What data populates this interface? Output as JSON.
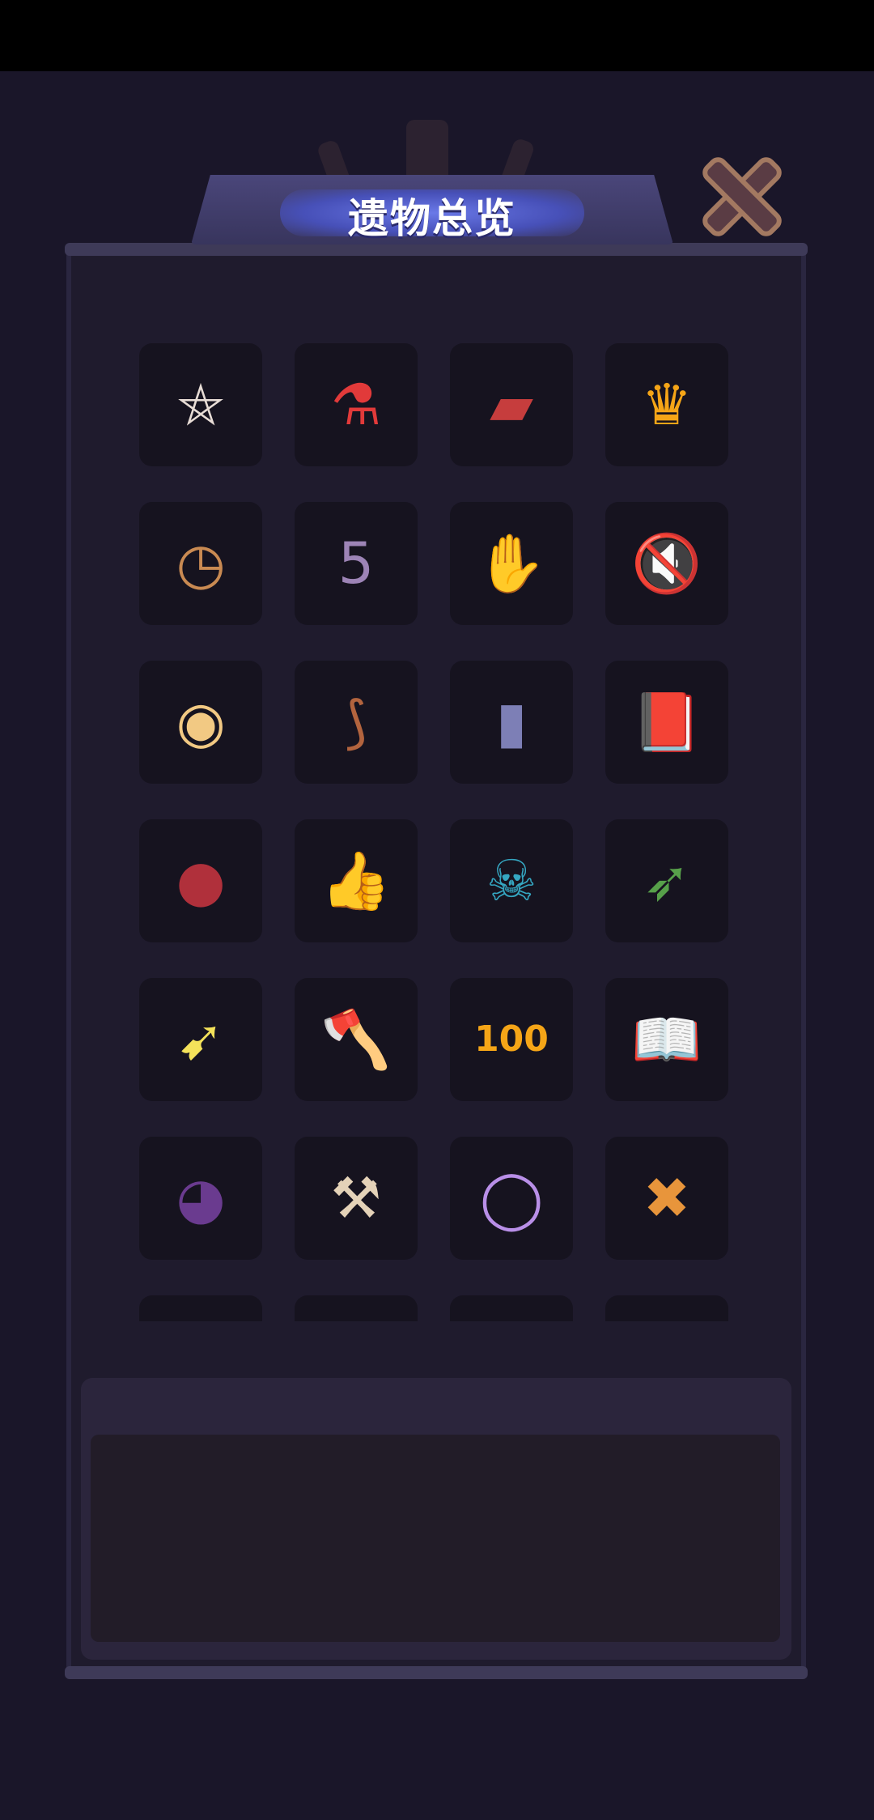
{
  "screen": {
    "title": "遗物总览"
  },
  "relics": [
    {
      "icon": "pentagram-plate-icon",
      "glyph": "⛤",
      "color": "#e8ddd6"
    },
    {
      "icon": "winged-potion-icon",
      "glyph": "⚗",
      "color": "#e23a3a"
    },
    {
      "icon": "red-armor-icon",
      "glyph": "▰",
      "color": "#c63d3d"
    },
    {
      "icon": "crown-card-icon",
      "glyph": "♛",
      "color": "#f5a517"
    },
    {
      "icon": "pocket-watch-icon",
      "glyph": "◷",
      "color": "#c98a52"
    },
    {
      "icon": "skull-calendar-icon",
      "glyph": "5",
      "color": "#9d84b6"
    },
    {
      "icon": "handshake-icon",
      "glyph": "✋",
      "color": "#e8dcc0"
    },
    {
      "icon": "mute-sound-icon",
      "glyph": "🔇",
      "color": "#34b39a"
    },
    {
      "icon": "round-shield-icon",
      "glyph": "◉",
      "color": "#f2c983"
    },
    {
      "icon": "wooden-bow-icon",
      "glyph": "⟆",
      "color": "#b3643e"
    },
    {
      "icon": "stone-block-icon",
      "glyph": "▮",
      "color": "#7d7fb6"
    },
    {
      "icon": "purple-spellbook-icon",
      "glyph": "📕",
      "color": "#a85ee0"
    },
    {
      "icon": "bitten-apple-icon",
      "glyph": "●",
      "color": "#b0303b"
    },
    {
      "icon": "thumbs-up-icon",
      "glyph": "👍",
      "color": "#f2c224"
    },
    {
      "icon": "vine-skull-icon",
      "glyph": "☠",
      "color": "#35a7c2"
    },
    {
      "icon": "arrow-quiver-icon",
      "glyph": "➶",
      "color": "#57a04a"
    },
    {
      "icon": "feather-arrow-icon",
      "glyph": "➹",
      "color": "#f4e25a"
    },
    {
      "icon": "purple-axe-icon",
      "glyph": "🪓",
      "color": "#7f4cb5"
    },
    {
      "icon": "level-100-house-icon",
      "glyph": "100",
      "color": "#f5a517"
    },
    {
      "icon": "cursed-spellbook-icon",
      "glyph": "📖",
      "color": "#e24fb0"
    },
    {
      "icon": "masked-face-icon",
      "glyph": "◕",
      "color": "#6a3b8f"
    },
    {
      "icon": "wooden-signpost-icon",
      "glyph": "⚒",
      "color": "#e4d2b8"
    },
    {
      "icon": "rainbow-ring-icon",
      "glyph": "◯",
      "color": "#b98fe8"
    },
    {
      "icon": "crossed-balloon-icon",
      "glyph": "✖",
      "color": "#e8953b"
    },
    {
      "icon": "cut-off-relic-1-icon",
      "glyph": "▲",
      "color": "#f3d27a"
    },
    {
      "icon": "cut-off-relic-2-icon",
      "glyph": "●",
      "color": "#6b3a3a"
    },
    {
      "icon": "cut-off-relic-3-icon",
      "glyph": "●",
      "color": "#c63030"
    },
    {
      "icon": "cut-off-relic-4-icon",
      "glyph": "●",
      "color": "#e79a3a"
    }
  ],
  "description": {
    "text": ""
  }
}
